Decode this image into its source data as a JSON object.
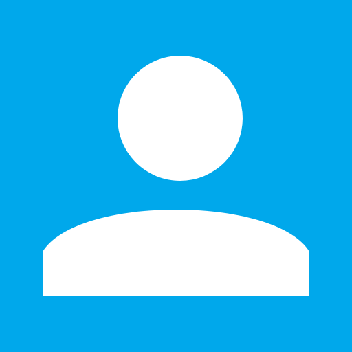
{
  "icon": {
    "name": "user-avatar-icon"
  },
  "colors": {
    "background": "#00a8eb",
    "foreground": "#ffffff"
  }
}
